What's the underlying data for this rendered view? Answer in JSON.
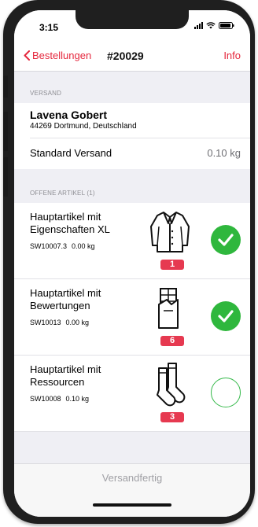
{
  "status_bar": {
    "time": "3:15",
    "icons": [
      "signal-icon",
      "wifi-icon",
      "battery-icon"
    ]
  },
  "nav": {
    "back_label": "Bestellungen",
    "title": "#20029",
    "info_label": "Info",
    "accent_color": "#e5273d"
  },
  "shipping": {
    "section_title": "VERSAND",
    "customer_name": "Lavena Gobert",
    "customer_address": "44269 Dortmund, Deutschland",
    "method": "Standard Versand",
    "weight": "0.10 kg"
  },
  "open_items": {
    "section_title": "OFFENE ARTIKEL (1)",
    "items": [
      {
        "name": "Hauptartikel mit Eigenschaften XL",
        "sku": "SW10007.3",
        "weight": "0.00 kg",
        "quantity": "1",
        "icon": "jacket-icon",
        "checked": true
      },
      {
        "name": "Hauptartikel mit Bewertungen",
        "sku": "SW10013",
        "weight": "0.00 kg",
        "quantity": "6",
        "icon": "chocolate-bar-icon",
        "checked": true
      },
      {
        "name": "Hauptartikel mit Ressourcen",
        "sku": "SW10008",
        "weight": "0.10 kg",
        "quantity": "3",
        "icon": "socks-icon",
        "checked": false
      }
    ]
  },
  "footer": {
    "action_label": "Versandfertig"
  },
  "colors": {
    "badge": "#e63950",
    "check_green": "#2fb73d",
    "background": "#efeff4"
  }
}
